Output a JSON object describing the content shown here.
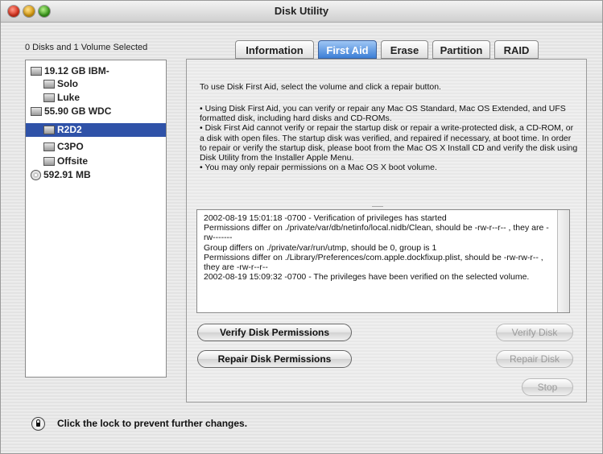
{
  "window": {
    "title": "Disk Utility"
  },
  "sidebar": {
    "status": "0 Disks and 1 Volume Selected",
    "items": [
      {
        "label": "19.12 GB IBM-",
        "icon": "disk-icon",
        "level": 0
      },
      {
        "label": "Solo",
        "icon": "volume-icon",
        "level": 1
      },
      {
        "label": "Luke",
        "icon": "volume-icon",
        "level": 1
      },
      {
        "label": "55.90 GB WDC",
        "icon": "disk-icon",
        "level": 0
      },
      {
        "label": "R2D2",
        "icon": "volume-icon",
        "level": 1,
        "selected": true
      },
      {
        "label": "C3PO",
        "icon": "volume-icon",
        "level": 1
      },
      {
        "label": "Offsite",
        "icon": "volume-icon",
        "level": 1
      },
      {
        "label": "592.91 MB",
        "icon": "cd-icon",
        "level": 0
      }
    ]
  },
  "tabs": [
    {
      "label": "Information"
    },
    {
      "label": "First Aid",
      "active": true
    },
    {
      "label": "Erase"
    },
    {
      "label": "Partition"
    },
    {
      "label": "RAID"
    }
  ],
  "firstaid": {
    "instruction": "To use Disk First Aid, select the volume and click a repair button.",
    "bullets": [
      "• Using Disk First Aid, you can verify or repair any Mac OS Standard, Mac OS Extended, and UFS formatted disk, including hard disks and CD-ROMs.",
      "• Disk First Aid cannot verify or repair the startup disk or repair a write-protected disk, a CD-ROM, or a disk with open files. The startup disk was verified, and repaired if necessary, at boot time. In order to repair or verify the startup disk, please boot from the Mac OS X Install CD and verify the disk using Disk Utility from the Installer Apple Menu.",
      "• You may only repair permissions on a Mac OS X boot volume."
    ],
    "log": [
      "2002-08-19 15:01:18 -0700 - Verification of privileges has started",
      "Permissions differ on ./private/var/db/netinfo/local.nidb/Clean, should be -rw-r--r-- , they are -rw-------",
      "Group differs on ./private/var/run/utmp, should be 0, group is 1",
      "Permissions differ on ./Library/Preferences/com.apple.dockfixup.plist, should be -rw-rw-r-- , they are -rw-r--r--",
      "2002-08-19 15:09:32 -0700 - The privileges have been verified on the selected volume."
    ],
    "buttons": {
      "verify_permissions": "Verify Disk Permissions",
      "repair_permissions": "Repair Disk Permissions",
      "verify_disk": "Verify Disk",
      "repair_disk": "Repair Disk",
      "stop": "Stop"
    }
  },
  "footer": {
    "lock_label": "Click the lock to prevent further changes.",
    "lock_icon": "lock-icon"
  },
  "colors": {
    "selection": "#2f52a8",
    "active_tab": "#3d7fd6"
  }
}
